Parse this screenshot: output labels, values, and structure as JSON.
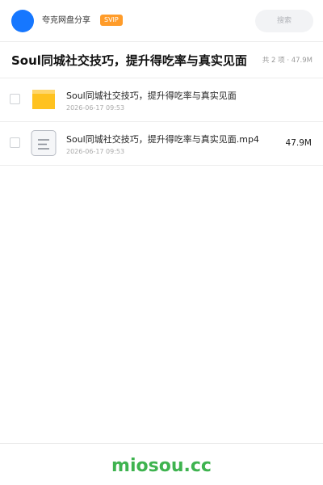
{
  "header": {
    "site_name": "夸克网盘分享",
    "badge": "SVIP",
    "search_placeholder": "搜索",
    "avatar_color": "#1677ff",
    "badge_color": "#ff9c2a"
  },
  "title_bar": {
    "title": "Soul同城社交技巧，提升得吃率与真实见面",
    "summary": "共 2 项 · 47.9M"
  },
  "files": [
    {
      "name": "Soul同城社交技巧，提升得吃率与真实见面",
      "date": "2026-06-17 09:53",
      "size": "",
      "icon": "folder-icon",
      "checked": false
    },
    {
      "name": "Soul同城社交技巧，提升得吃率与真实见面.mp4",
      "date": "2026-06-17 09:53",
      "size": "47.9M",
      "icon": "video-file-icon",
      "checked": false
    }
  ],
  "footer": {
    "watermark": "miosou.cc",
    "watermark_color": "#3eb34f"
  }
}
